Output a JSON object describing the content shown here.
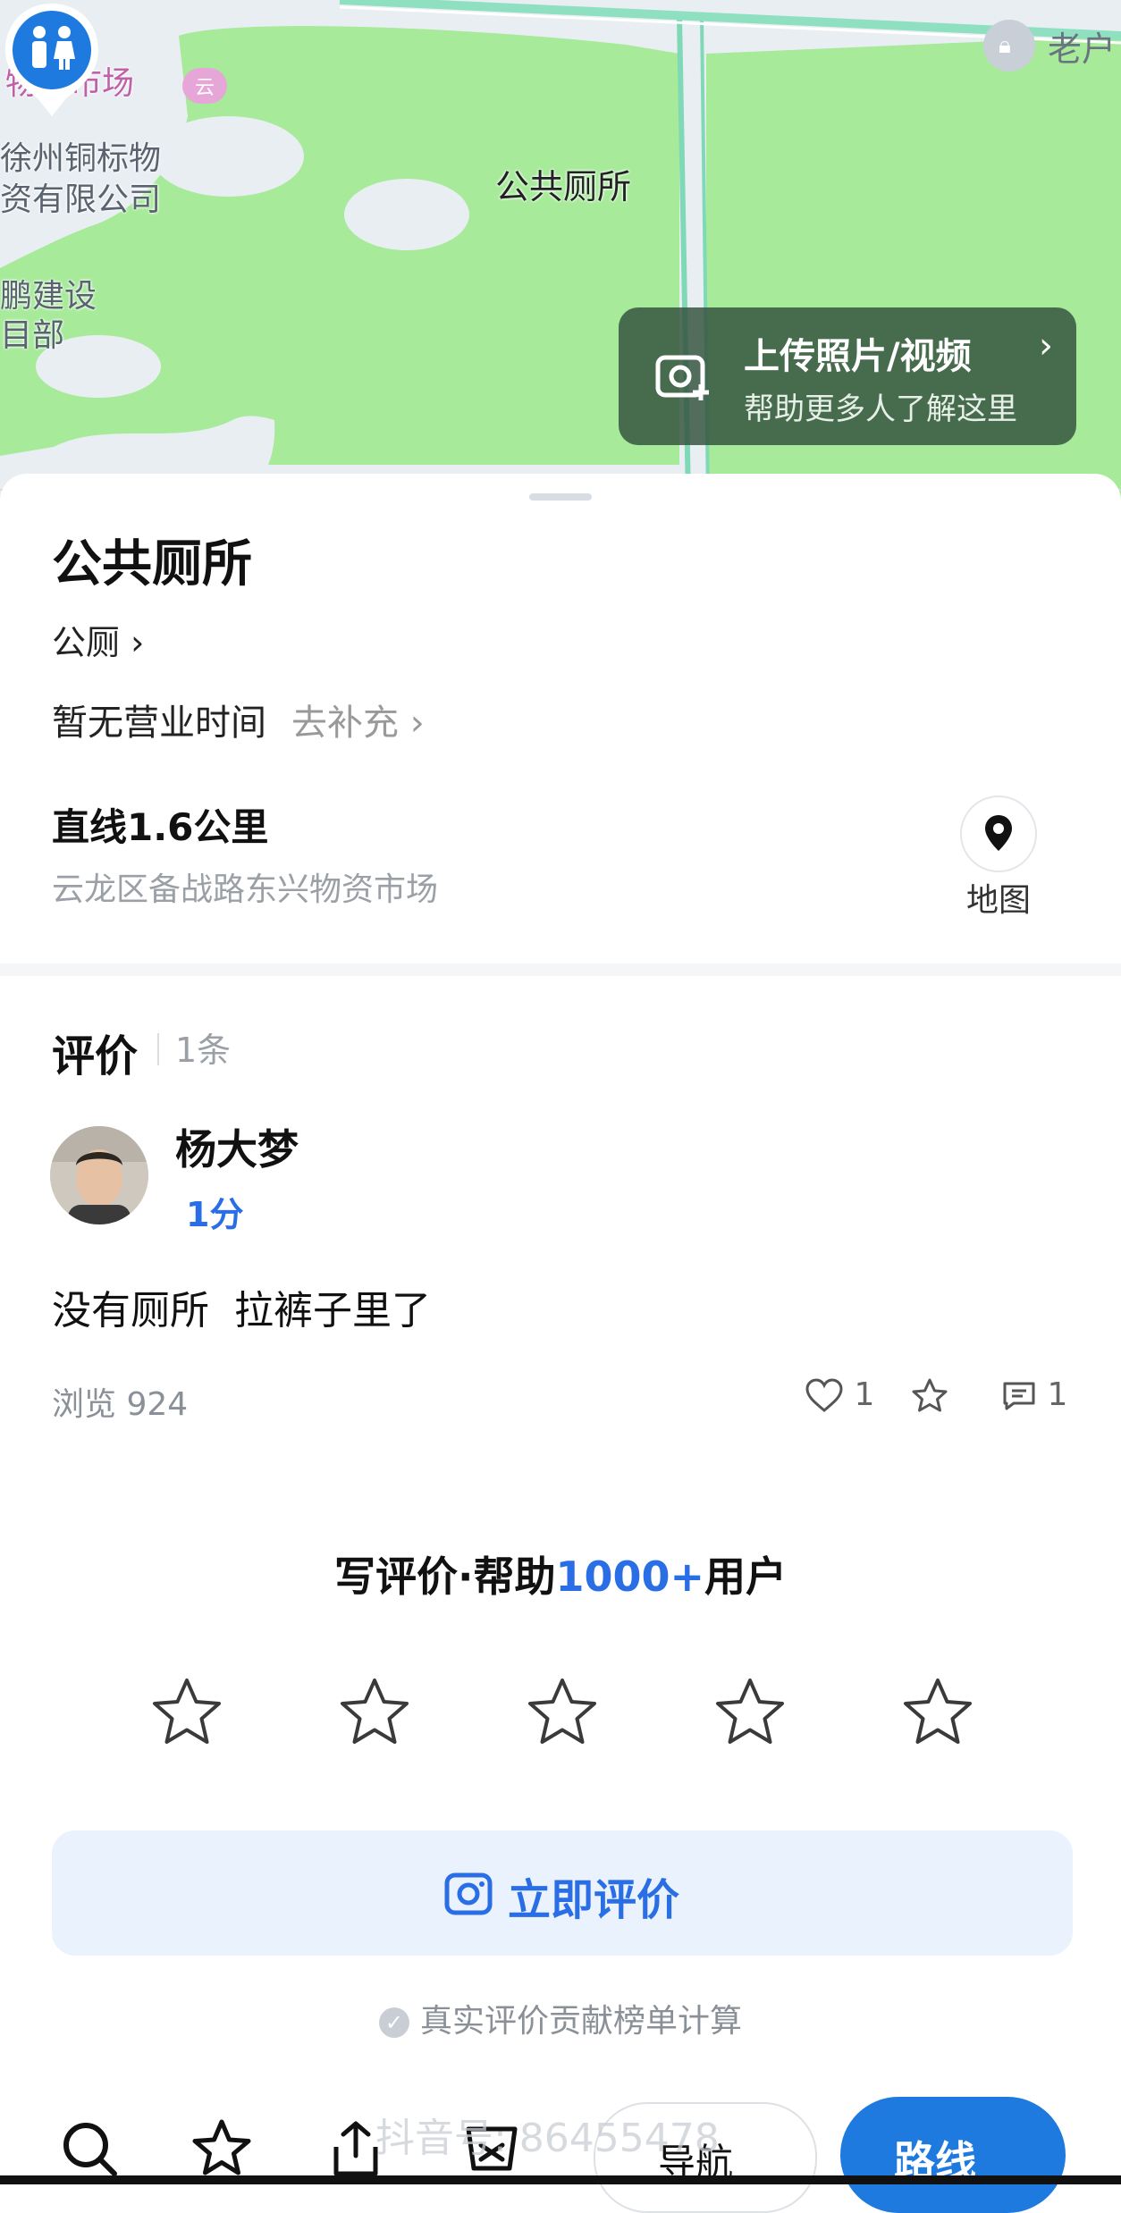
{
  "map": {
    "labels": {
      "market": "物资市场",
      "company_line1": "徐州铜标物",
      "company_line2": "资有限公司",
      "project_line1": "鹏建设",
      "project_line2": "目部"
    },
    "poi_name": "公共厕所",
    "user_label": "老户",
    "upload_card": {
      "title": "上传照片/视频",
      "subtitle": "帮助更多人了解这里"
    }
  },
  "place": {
    "title": "公共厕所",
    "category": "公厕",
    "hours": "暂无营业时间",
    "hours_action": "去补充",
    "distance": "直线1.6公里",
    "address": "云龙区备战路东兴物资市场",
    "map_button": "地图"
  },
  "reviews": {
    "title": "评价",
    "count": "1条",
    "items": [
      {
        "author": "杨大梦",
        "score": "1分",
        "text": "没有厕所  拉裤子里了",
        "views": "浏览 924",
        "likes": "1",
        "comments": "1"
      }
    ]
  },
  "write_review": {
    "prefix": "写评价·帮助",
    "highlight": "1000+",
    "suffix": "用户",
    "button": "立即评价",
    "note": "真实评价贡献榜单计算"
  },
  "bottom_bar": {
    "nav_label": "导航",
    "route_label": "路线",
    "watermark": "抖音号: 86455478"
  },
  "colors": {
    "accent": "#2a6ee6",
    "route_button": "#1f7ae0",
    "map_green": "#a6ea9a"
  }
}
